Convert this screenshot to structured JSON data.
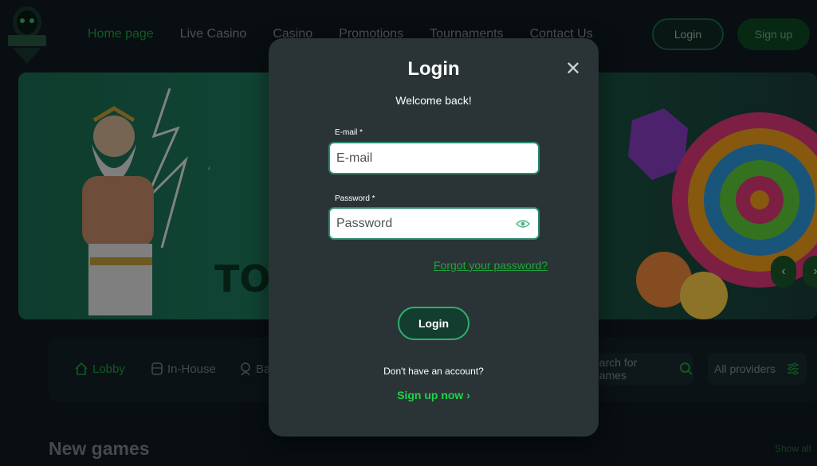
{
  "header": {
    "nav": [
      {
        "label": "Home page"
      },
      {
        "label": "Live Casino"
      },
      {
        "label": "Casino"
      },
      {
        "label": "Promotions"
      },
      {
        "label": "Tournaments"
      },
      {
        "label": "Contact Us"
      }
    ],
    "login_label": "Login",
    "signup_label": "Sign up"
  },
  "banner": {
    "text_fragment": "TO",
    "prev_icon": "chevron-left-icon",
    "next_icon": "chevron-right-icon"
  },
  "categories": {
    "items": [
      {
        "label": "Lobby",
        "icon": "home-icon"
      },
      {
        "label": "In-House",
        "icon": "cup-icon"
      },
      {
        "label": "Ba",
        "icon": "card-icon"
      }
    ],
    "search_placeholder": "earch for games",
    "providers_label": "All providers"
  },
  "section": {
    "title": "New games",
    "show_all": "Show all"
  },
  "modal": {
    "title": "Login",
    "subtitle": "Welcome back!",
    "email_label": "E-mail *",
    "email_placeholder": "E-mail",
    "password_label": "Password *",
    "password_placeholder": "Password",
    "forgot_link": "Forgot your password?",
    "login_button": "Login",
    "no_account_text": "Don't have an account?",
    "signup_link": "Sign up now"
  },
  "colors": {
    "accent_green": "#1fa63c",
    "modal_bg": "#2a3437",
    "page_bg": "#0f1a1f"
  }
}
